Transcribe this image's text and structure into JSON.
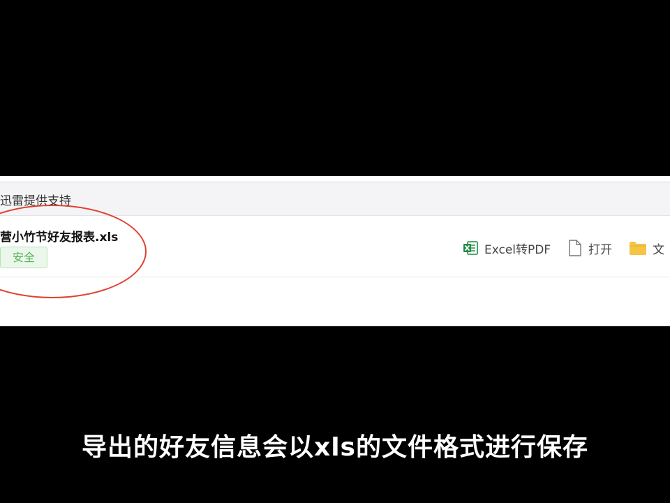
{
  "panel": {
    "provider_text": "迅雷提供支持",
    "download": {
      "file_name": "营小竹节好友报表.xls",
      "status_badge": "安全",
      "actions": [
        {
          "label": "Excel转PDF",
          "icon": "excel-icon"
        },
        {
          "label": "打开",
          "icon": "document-icon"
        },
        {
          "label": "文",
          "icon": "folder-icon"
        }
      ]
    }
  },
  "subtitle": "导出的好友信息会以xls的文件格式进行保存",
  "colors": {
    "annotation": "#e0412f",
    "safe_badge_text": "#55b255",
    "excel_green": "#1f8a44",
    "folder_yellow": "#f5c443"
  }
}
